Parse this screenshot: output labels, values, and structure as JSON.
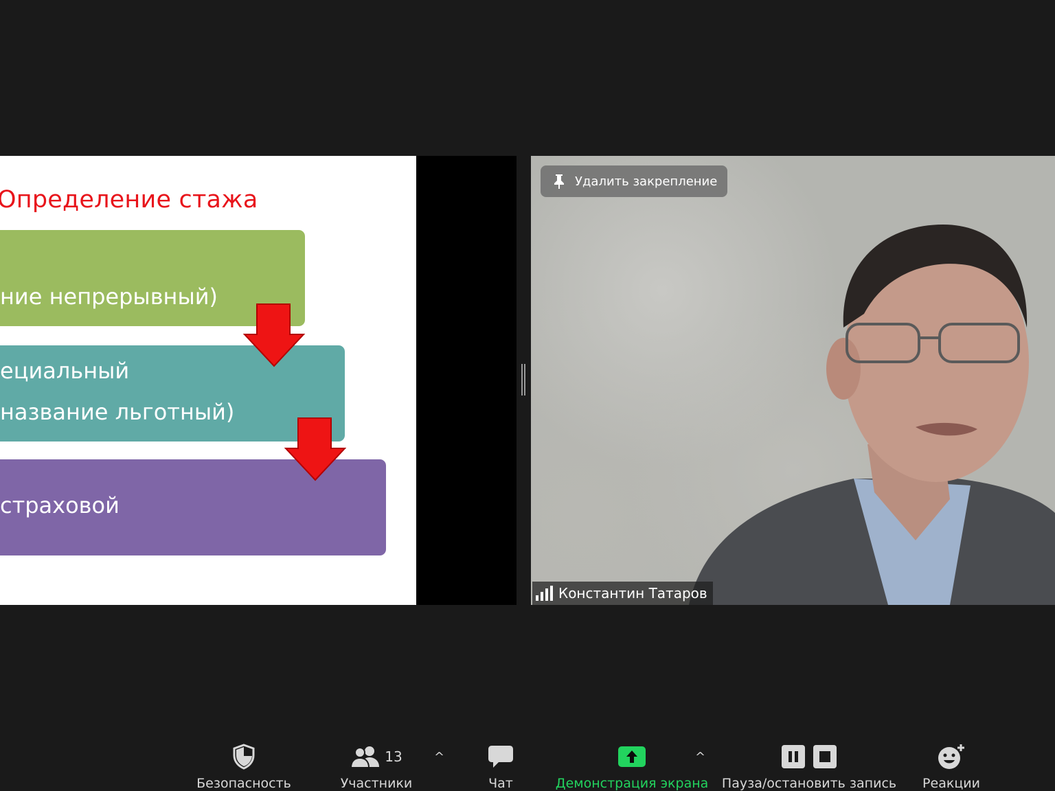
{
  "slide": {
    "title": "Определение стажа",
    "steps": [
      {
        "lines": [
          "ние непрерывный)"
        ],
        "color": "#9bbb5f"
      },
      {
        "lines": [
          "ециальный",
          "название льготный)"
        ],
        "color": "#60aaa6"
      },
      {
        "lines": [
          " страховой"
        ],
        "color": "#7f66a7"
      }
    ],
    "arrow_color": "#ee1414"
  },
  "video": {
    "unpin_label": "Удалить закрепление",
    "participant_name": "Константин Татаров"
  },
  "toolbar": {
    "security": "Безопасность",
    "participants": "Участники",
    "participants_count": "13",
    "chat": "Чат",
    "share_screen": "Демонстрация экрана",
    "pause_stop_recording": "Пауза/остановить запись",
    "reactions": "Реакции",
    "caret": "^"
  },
  "colors": {
    "share_green": "#22d35e",
    "title_red": "#e8141b"
  }
}
